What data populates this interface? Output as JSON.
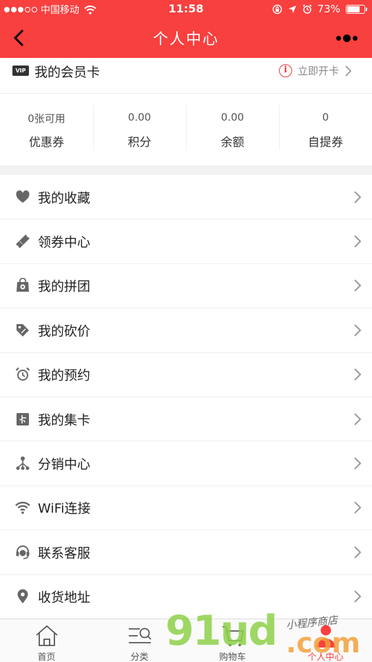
{
  "status_bar": {
    "carrier": "中国移动",
    "time": "11:58",
    "battery": "73%",
    "battery_level": 0.73
  },
  "header": {
    "title": "个人中心"
  },
  "member_card": {
    "badge": "VIP",
    "title": "我的会员卡",
    "action": "立即开卡",
    "info_icon_glyph": "i"
  },
  "stats": [
    {
      "value": "0张可用",
      "label": "优惠券"
    },
    {
      "value": "0.00",
      "label": "积分"
    },
    {
      "value": "0.00",
      "label": "余额"
    },
    {
      "value": "0",
      "label": "自提券"
    }
  ],
  "menu": [
    {
      "label": "我的收藏",
      "icon": "heart-icon"
    },
    {
      "label": "领券中心",
      "icon": "ticket-icon"
    },
    {
      "label": "我的拼团",
      "icon": "group-bag-icon"
    },
    {
      "label": "我的砍价",
      "icon": "price-tag-icon"
    },
    {
      "label": "我的预约",
      "icon": "alarm-clock-icon"
    },
    {
      "label": "我的集卡",
      "icon": "card-icon"
    },
    {
      "label": "分销中心",
      "icon": "distribution-icon"
    },
    {
      "label": "WiFi连接",
      "icon": "wifi-icon"
    },
    {
      "label": "联系客服",
      "icon": "headset-icon"
    },
    {
      "label": "收货地址",
      "icon": "location-pin-icon"
    }
  ],
  "tabbar": [
    {
      "label": "首页",
      "icon": "home-icon"
    },
    {
      "label": "分类",
      "icon": "category-search-icon"
    },
    {
      "label": "购物车",
      "icon": "cart-icon"
    },
    {
      "label": "个人中心",
      "icon": "user-icon",
      "active": true
    }
  ],
  "watermark": {
    "main": "91ud",
    "suffix": ".com",
    "tagline": "小程序商店"
  },
  "colors": {
    "brand_red": "#f8403f",
    "icon_gray": "#666666",
    "watermark_green": "#8fd14a",
    "watermark_orange": "#f3a13c"
  }
}
